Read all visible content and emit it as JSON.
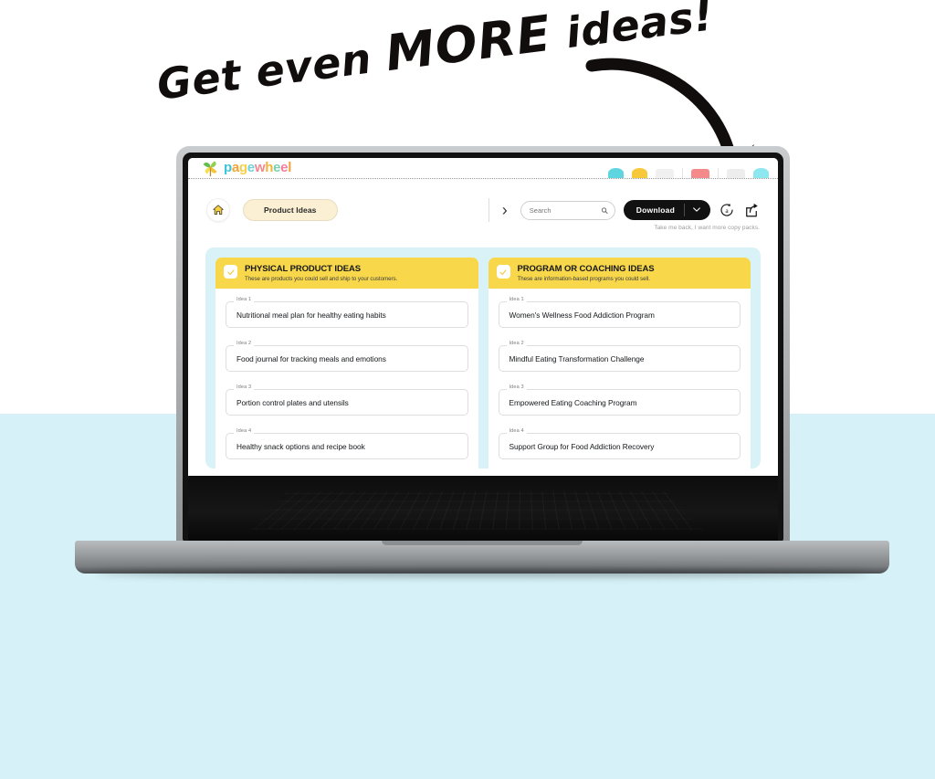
{
  "annotation": {
    "headline_part1": "Get even ",
    "headline_more": "MORE",
    "headline_part2": " ideas!",
    "arrow_name": "curved-arrow-pointing-to-regenerate"
  },
  "app": {
    "brand_name": "pagewheel",
    "brand_letters": [
      {
        "ch": "p",
        "color": "#3bc6d8"
      },
      {
        "ch": "a",
        "color": "#f3a33a"
      },
      {
        "ch": "g",
        "color": "#f7d04a"
      },
      {
        "ch": "e",
        "color": "#6fd3d8"
      },
      {
        "ch": "w",
        "color": "#f2878f"
      },
      {
        "ch": "h",
        "color": "#f2b63a"
      },
      {
        "ch": "e",
        "color": "#7ad3b0"
      },
      {
        "ch": "e",
        "color": "#f37d9e"
      },
      {
        "ch": "l",
        "color": "#f2a23a"
      }
    ]
  },
  "header": {
    "home_icon": "home-icon",
    "breadcrumb": "Product Ideas",
    "chevron": "›",
    "search": {
      "value": "",
      "placeholder": "Search",
      "icon": "search-icon"
    },
    "download": {
      "label": "Download",
      "caret": "⌄",
      "caret_icon": "chevron-down-icon"
    },
    "regenerate_icon": "regenerate-a-icon",
    "share_icon": "share-export-icon",
    "subnote": "Take me back, I want more copy packs."
  },
  "columns": [
    {
      "checked": true,
      "title": "PHYSICAL PRODUCT IDEAS",
      "subtitle": "These are products you could sell and ship to your customers.",
      "ideas": [
        {
          "label": "Idea 1",
          "text": "Nutritional meal plan for healthy eating habits"
        },
        {
          "label": "Idea 2",
          "text": "Food journal for tracking meals and emotions"
        },
        {
          "label": "Idea 3",
          "text": "Portion control plates and utensils"
        },
        {
          "label": "Idea 4",
          "text": "Healthy snack options and recipe book"
        }
      ]
    },
    {
      "checked": true,
      "title": "PROGRAM OR COACHING IDEAS",
      "subtitle": "These are information-based programs you could sell.",
      "ideas": [
        {
          "label": "Idea 1",
          "text": "Women's Wellness Food Addiction Program"
        },
        {
          "label": "Idea 2",
          "text": "Mindful Eating Transformation Challenge"
        },
        {
          "label": "Idea 3",
          "text": "Empowered Eating Coaching Program"
        },
        {
          "label": "Idea 4",
          "text": "Support Group for Food Addiction Recovery"
        }
      ]
    }
  ],
  "colors": {
    "page_background_top": "#ffffff",
    "page_background_bottom": "#d6f2f8",
    "panel_background": "#d9f2f7",
    "card_header_yellow": "#f8d74b",
    "breadcrumb_pill": "#fbf0d4",
    "download_button": "#111111",
    "annotation_ink": "#120d0d"
  }
}
